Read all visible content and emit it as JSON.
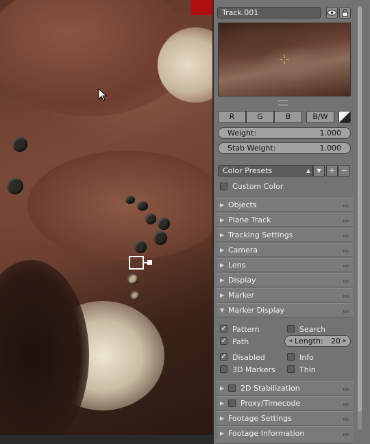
{
  "viewport": {
    "name": "Movie clip viewport"
  },
  "track": {
    "name": "Track.001"
  },
  "channels": {
    "r": "R",
    "g": "G",
    "b": "B",
    "bw": "B/W"
  },
  "sliders": {
    "weight_label": "Weight:",
    "weight_value": "1.000",
    "stab_label": "Stab Weight:",
    "stab_value": "1.000"
  },
  "color_presets": {
    "label": "Color Presets",
    "add": "+",
    "remove": "−"
  },
  "custom_color": {
    "label": "Custom Color",
    "checked": false
  },
  "sections": {
    "objects": "Objects",
    "plane_track": "Plane Track",
    "tracking_settings": "Tracking Settings",
    "camera": "Camera",
    "lens": "Lens",
    "display": "Display",
    "marker": "Marker",
    "marker_display": "Marker Display",
    "stabilization": "2D Stabilization",
    "proxy": "Proxy/Timecode",
    "footage_settings": "Footage Settings",
    "footage_information": "Footage Information"
  },
  "marker_display": {
    "pattern": "Pattern",
    "search": "Search",
    "path": "Path",
    "length_label": "Length:",
    "length_value": "20",
    "disabled": "Disabled",
    "info": "Info",
    "markers_3d": "3D Markers",
    "thin": "Thin"
  },
  "icons": {
    "eye": "eye-icon",
    "lock": "lock-icon",
    "preset_dropdown": "updown-arrows-icon",
    "expand": "triangle-right-icon",
    "collapse": "triangle-down-icon",
    "cursor": "mouse-pointer-icon",
    "crosshair": "crosshair-icon"
  },
  "colors": {
    "panel_bg": "#737373",
    "section_bg": "#7a7a7a",
    "field_dark": "#5c5c5c",
    "slider_bg": "#a3a3a3",
    "red_corner": "#b01010"
  }
}
